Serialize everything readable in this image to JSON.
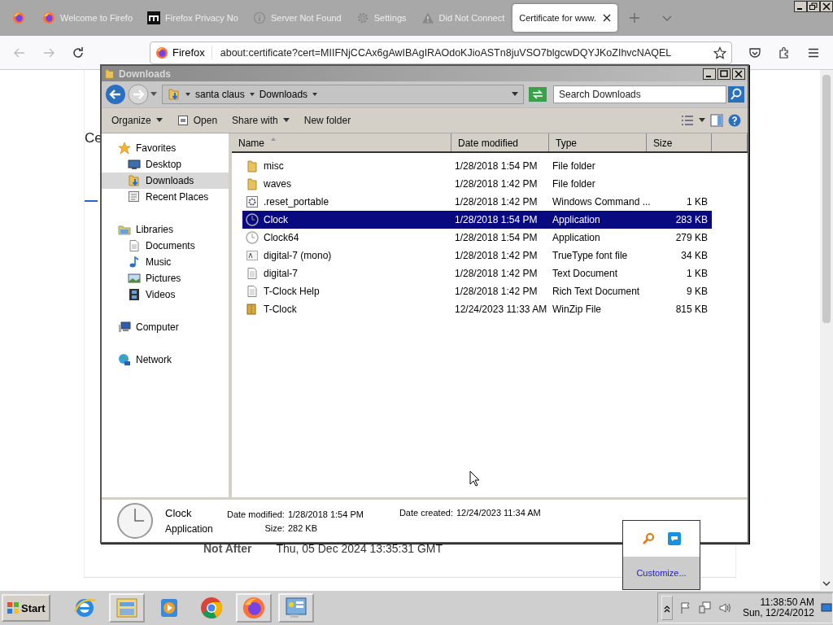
{
  "browser": {
    "tabs": [
      {
        "kind": "firefox",
        "selected": false
      },
      {
        "kind": "firefox",
        "title": "Welcome to Firefo",
        "selected": false
      },
      {
        "kind": "mozilla",
        "title": "Firefox Privacy No",
        "selected": false
      },
      {
        "kind": "info",
        "title": "Server Not Found",
        "selected": false
      },
      {
        "kind": "gear",
        "title": "Settings",
        "selected": false
      },
      {
        "kind": "warning",
        "title": "Did Not Connect",
        "selected": false
      },
      {
        "kind": "plain",
        "title": "Certificate for www.",
        "selected": true
      }
    ],
    "nav": [
      {
        "kind": "back",
        "disabled": true
      },
      {
        "kind": "forward",
        "disabled": true
      },
      {
        "kind": "reload",
        "disabled": false
      }
    ],
    "identity": "Firefox",
    "url": "about:certificate?cert=MIIFNjCCAx6gAwIBAgIRAOdoKJioASTn8juVSO7blgcwDQYJKoZIhvcNAQEL",
    "page": {
      "heading": "Ce",
      "row_label": "Not After",
      "row_value": "Thu, 05 Dec 2024 13:35:31 GMT"
    }
  },
  "explorer": {
    "title": "Downloads",
    "breadcrumbs": [
      "santa claus",
      "Downloads"
    ],
    "search": {
      "placeholder": "Search Downloads"
    },
    "toolbar": [
      {
        "label": "Organize",
        "kind": "menu"
      },
      {
        "label": "Open",
        "kind": "open"
      },
      {
        "label": "Share with",
        "kind": "menu"
      },
      {
        "label": "New folder",
        "kind": "plain"
      }
    ],
    "nav_pane": [
      {
        "label": "Favorites",
        "kind": "star",
        "selected": false,
        "children": [
          {
            "label": "Desktop",
            "kind": "desktop",
            "selected": false
          },
          {
            "label": "Downloads",
            "kind": "download",
            "selected": true
          },
          {
            "label": "Recent Places",
            "kind": "recent",
            "selected": false
          }
        ]
      },
      {
        "label": "Libraries",
        "kind": "libraries",
        "selected": false,
        "children": [
          {
            "label": "Documents",
            "kind": "document",
            "selected": false
          },
          {
            "label": "Music",
            "kind": "music",
            "selected": false
          },
          {
            "label": "Pictures",
            "kind": "pictures",
            "selected": false
          },
          {
            "label": "Videos",
            "kind": "videos",
            "selected": false
          }
        ]
      },
      {
        "label": "Computer",
        "kind": "computer",
        "selected": false
      },
      {
        "label": "Network",
        "kind": "network",
        "selected": false
      }
    ],
    "columns": [
      "Name",
      "Date modified",
      "Type",
      "Size"
    ],
    "files": [
      {
        "kind": "folder",
        "name": "misc",
        "date": "1/28/2018 1:54 PM",
        "type": "File folder",
        "selected": false
      },
      {
        "kind": "folder",
        "name": "waves",
        "date": "1/28/2018 1:42 PM",
        "type": "File folder",
        "selected": false
      },
      {
        "kind": "batch",
        "name": ".reset_portable",
        "date": "1/28/2018 1:42 PM",
        "type": "Windows Command ...",
        "size": "1 KB",
        "selected": false
      },
      {
        "kind": "clock",
        "name": "Clock",
        "date": "1/28/2018 1:54 PM",
        "type": "Application",
        "size": "283 KB",
        "selected": true
      },
      {
        "kind": "clock",
        "name": "Clock64",
        "date": "1/28/2018 1:54 PM",
        "type": "Application",
        "size": "279 KB",
        "selected": false
      },
      {
        "kind": "font",
        "name": "digital-7 (mono)",
        "date": "1/28/2018 1:42 PM",
        "type": "TrueType font file",
        "size": "34 KB",
        "selected": false
      },
      {
        "kind": "text",
        "name": "digital-7",
        "date": "1/28/2018 1:42 PM",
        "type": "Text Document",
        "size": "1 KB",
        "selected": false
      },
      {
        "kind": "text",
        "name": "T-Clock Help",
        "date": "1/28/2018 1:42 PM",
        "type": "Rich Text Document",
        "size": "9 KB",
        "selected": false
      },
      {
        "kind": "zip",
        "name": "T-Clock",
        "date": "12/24/2023 11:33 AM",
        "type": "WinZip File",
        "size": "815 KB",
        "selected": false
      }
    ],
    "details": {
      "name": "Clock",
      "type": "Application",
      "modified_label": "Date modified:",
      "modified": "1/28/2018 1:54 PM",
      "size_label": "Size:",
      "size": "282 KB",
      "created_label": "Date created:",
      "created": "12/24/2023 11:34 AM"
    }
  },
  "tray_popup": {
    "link": "Customize..."
  },
  "taskbar": {
    "start": "Start",
    "apps": [
      {
        "kind": "ie",
        "open": false
      },
      {
        "kind": "explorer",
        "open": true
      },
      {
        "kind": "media",
        "open": false
      },
      {
        "kind": "chrome",
        "open": false
      },
      {
        "kind": "firefox",
        "open": true
      },
      {
        "kind": "server",
        "open": true
      }
    ],
    "time": "11:38:50 AM",
    "date": "Sun, 12/24/2012"
  }
}
